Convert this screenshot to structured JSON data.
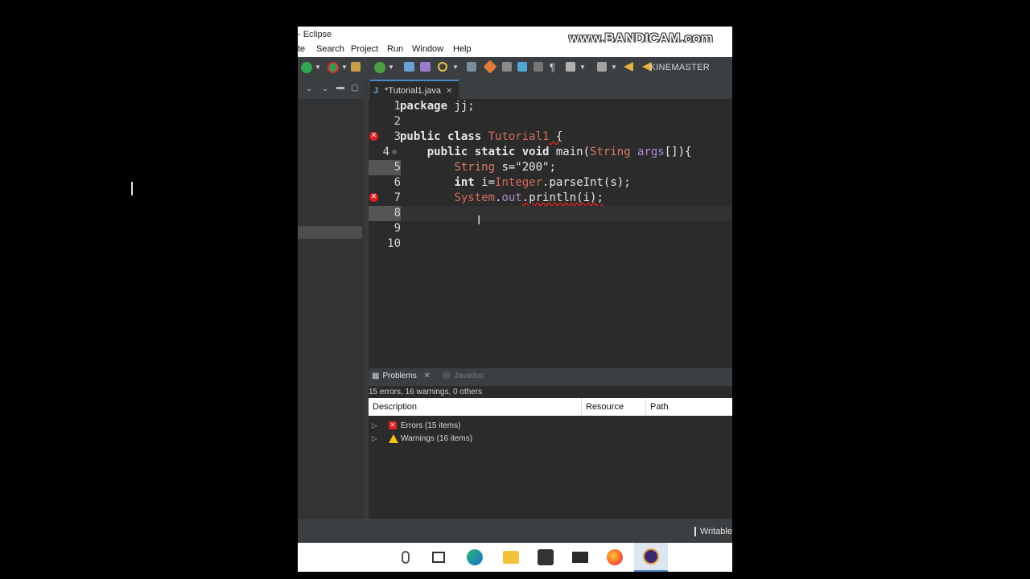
{
  "window": {
    "title": "- Eclipse"
  },
  "watermark": "www.BANDICAM.com",
  "overlay_text": "KINEMASTER",
  "menu": [
    "te",
    "Search",
    "Project",
    "Run",
    "Window",
    "Help"
  ],
  "editor": {
    "tab_label": "*Tutorial1.java",
    "lines": [
      {
        "num": "1",
        "error": false
      },
      {
        "num": "2",
        "error": false
      },
      {
        "num": "3",
        "error": true
      },
      {
        "num": "4",
        "error": false
      },
      {
        "num": "5",
        "error": false
      },
      {
        "num": "6",
        "error": false
      },
      {
        "num": "7",
        "error": true
      },
      {
        "num": "8",
        "error": false
      },
      {
        "num": "9",
        "error": false
      },
      {
        "num": "10",
        "error": false
      }
    ],
    "code": {
      "l1_kw": "package",
      "l1_rest": " jj;",
      "l3_kw": "public class",
      "l3_cls": "Tutorial1",
      "l3_rest": " {",
      "l4_kw": "public static void",
      "l4_rest": " main(",
      "l4_typ": "String",
      "l4_arg": " args",
      "l4_end": "[]){",
      "l5_typ": "String",
      "l5_rest": " s=\"200\";",
      "l6_kw": "int",
      "l6_id": " i=",
      "l6_cls": "Integer",
      "l6_rest": ".parseInt(s);",
      "l7_cls": "System",
      "l7_dot": ".",
      "l7_fld": "out",
      "l7_rest": ".println(i);"
    }
  },
  "problems": {
    "tab_label": "Problems",
    "javadoc_label": "Javadoc",
    "summary": "15 errors, 16 warnings, 0 others",
    "columns": {
      "description": "Description",
      "resource": "Resource",
      "path": "Path"
    },
    "rows": [
      {
        "label": "Errors (15 items)",
        "kind": "error"
      },
      {
        "label": "Warnings (16 items)",
        "kind": "warning"
      }
    ]
  },
  "status": {
    "writable": "Writable"
  },
  "colors": {
    "error": "#e02020",
    "warning": "#f2c21a",
    "accent": "#4a88c7"
  }
}
